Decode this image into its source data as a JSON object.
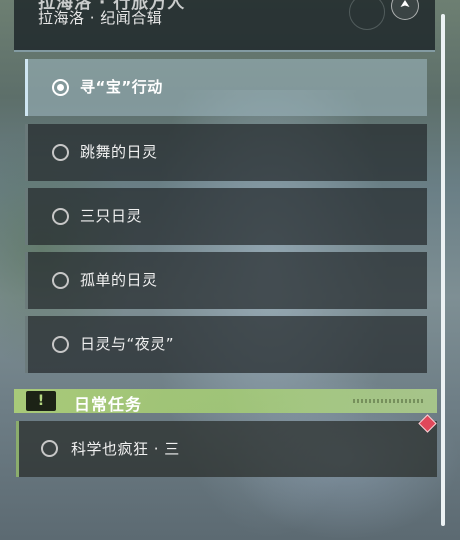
{
  "header": {
    "title": "拉海洛 · 行旅万人",
    "subtitle": "拉海洛 · 纪闻合辑",
    "badge_icon": "arrow-up-icon"
  },
  "quests": [
    {
      "label": "寻“宝”行动",
      "selected": true
    },
    {
      "label": "跳舞的日灵",
      "selected": false
    },
    {
      "label": "三只日灵",
      "selected": false
    },
    {
      "label": "孤单的日灵",
      "selected": false
    },
    {
      "label": "日灵与“夜灵”",
      "selected": false
    }
  ],
  "daily": {
    "section_icon": "!",
    "section_title": "日常任务",
    "quest_label": "科学也疯狂 · 三",
    "marker_icon": "red-diamond-icon"
  },
  "colors": {
    "accent_active": "#cfe6f2",
    "daily_green": "#b5d882",
    "marker_red": "#e0485a"
  }
}
